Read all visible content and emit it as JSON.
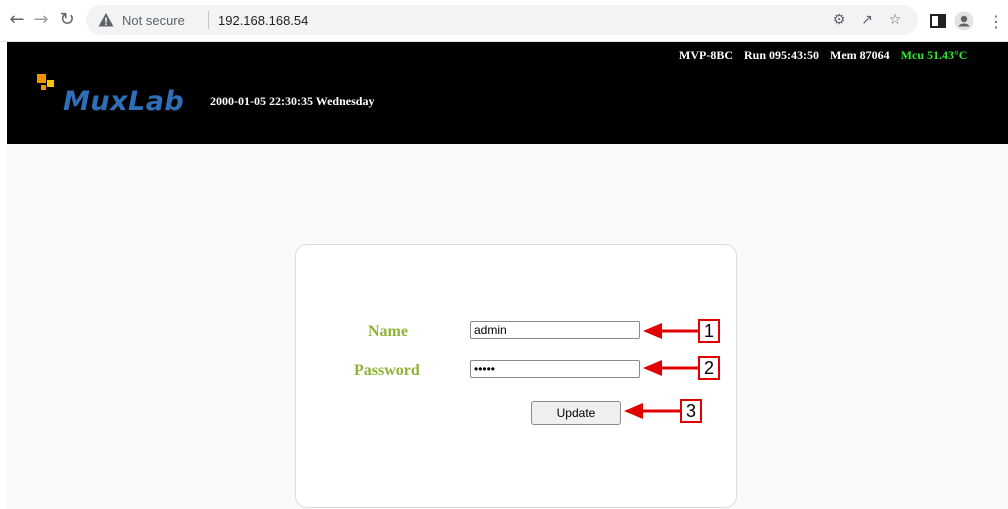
{
  "browser": {
    "security_label": "Not secure",
    "url": "192.168.168.54"
  },
  "header": {
    "logo_text": "MuxLab",
    "datetime": "2000-01-05 22:30:35 Wednesday",
    "device": "MVP-8BC",
    "run": "Run 095:43:50",
    "mem": "Mem 87064",
    "mcu": "Mcu 51.43°C",
    "mcu_color": "#2fe82f",
    "label_color": "#8fb236"
  },
  "login": {
    "name_label": "Name",
    "password_label": "Password",
    "name_value": "admin",
    "password_value": "•••••",
    "update_label": "Update"
  },
  "callouts": {
    "one": "1",
    "two": "2",
    "three": "3"
  }
}
